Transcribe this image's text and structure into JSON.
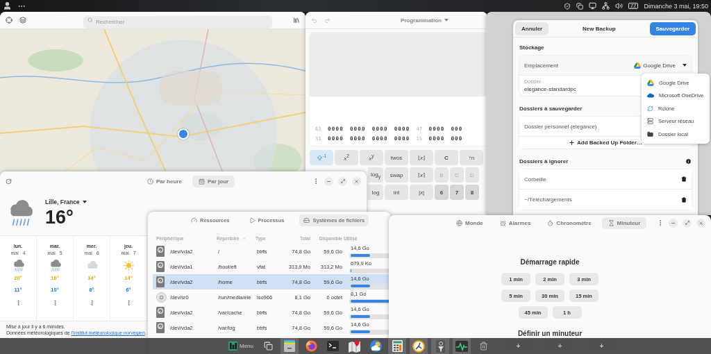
{
  "top_panel": {
    "indicator": "ZZ",
    "clock": "Dimanche 3 mai, 19:50"
  },
  "maps": {
    "search": {
      "placeholder": "Rechercher"
    }
  },
  "calculator": {
    "mode": "Programmation",
    "bit_rows": [
      {
        "segments": [
          {
            "label": "63",
            "groups": [
              "0000",
              "0000",
              "0000",
              "0000"
            ]
          },
          {
            "label": "47",
            "groups": [
              "0000",
              "000"
            ]
          }
        ]
      },
      {
        "segments": [
          {
            "label": "31",
            "groups": [
              "0000",
              "0000",
              "0000",
              "0000"
            ]
          },
          {
            "label": "15",
            "groups": [
              "0000",
              "000"
            ]
          }
        ]
      }
    ],
    "keys": [
      [
        {
          "label": "$^{-1}$",
          "kind": "toggle",
          "on": true
        },
        {
          "label": "*x*$^{2}$",
          "kind": "function"
        },
        {
          "label": "*x*$^{y}$",
          "kind": "function"
        },
        {
          "label": "twos",
          "kind": "function"
        },
        {
          "label": "⌊*x*⌋",
          "kind": "function"
        },
        {
          "label": "C",
          "kind": "clear"
        },
        {
          "label": "↑n",
          "kind": "function"
        }
      ],
      [
        {
          "label": "log$_{y}$",
          "kind": "function"
        },
        {
          "label": "swap",
          "kind": "function"
        },
        {
          "label": "⌈*x*⌉",
          "kind": "function"
        },
        {
          "label": "B",
          "kind": "digit",
          "disabled": true
        },
        {
          "label": "C",
          "kind": "digit",
          "disabled": true
        },
        {
          "label": "D",
          "kind": "digit",
          "disabled": true
        }
      ],
      [
        {
          "label": "log",
          "kind": "function"
        },
        {
          "label": "int",
          "kind": "function"
        },
        {
          "label": "|*x*|",
          "kind": "function"
        },
        {
          "label": "6",
          "kind": "digit",
          "disabled": false
        },
        {
          "label": "7",
          "kind": "digit",
          "disabled": false
        },
        {
          "label": "8",
          "kind": "digit",
          "disabled": false
        }
      ]
    ]
  },
  "backup": {
    "cancel": "Annuler",
    "title": "New Backup",
    "save": "Sauvegarder",
    "storage": {
      "heading": "Stockage",
      "location_label": "Emplacement",
      "location_value": "Google Drive",
      "folder_label": "Dossier",
      "folder_value": "elegance-standardpc"
    },
    "include": {
      "heading": "Dossiers à sauvegarder",
      "items": [
        "Dossier personnel (elegance)"
      ],
      "add": "Add Backed Up Folder…"
    },
    "exclude": {
      "heading": "Dossiers à ignorer",
      "items": [
        "Corbeille",
        "~/Téléchargements"
      ]
    },
    "location_menu": [
      {
        "label": "Google Drive",
        "kind": "gdrive"
      },
      {
        "label": "Microsoft OneDrive",
        "kind": "onedrive"
      },
      {
        "label": "Rclone",
        "kind": "rclone"
      },
      {
        "label": "Serveur réseau",
        "kind": "server"
      },
      {
        "label": "Dossier local",
        "kind": "folder"
      }
    ]
  },
  "weather": {
    "tabs": [
      {
        "label": "Par heure",
        "selected": false
      },
      {
        "label": "Par jour",
        "selected": true
      }
    ],
    "current": {
      "location": "Lille, France",
      "temperature": "16°",
      "kind": "rain"
    },
    "forecast": [
      {
        "day": "lun.",
        "month": "mai",
        "date": "4",
        "kind": "rain",
        "high": "20°",
        "low": "11°"
      },
      {
        "day": "mar.",
        "month": "mai",
        "date": "5",
        "kind": "rain",
        "high": "16°",
        "low": "10°"
      },
      {
        "day": "mer.",
        "month": "mai",
        "date": "6",
        "kind": "cloud",
        "high": "14°",
        "low": "8°"
      },
      {
        "day": "jeu.",
        "month": "mai",
        "date": "7",
        "kind": "sun",
        "high": "14°",
        "low": "6°"
      }
    ],
    "updated": "Mise à jour il y a 6 minutes.",
    "credit": "Données météorologiques de ",
    "credit_link": "l'Institut météorologique norvégien",
    "credit_end": "."
  },
  "system_monitor": {
    "tabs": [
      {
        "label": "Ressources",
        "selected": false
      },
      {
        "label": "Processus",
        "selected": false
      },
      {
        "label": "Systèmes de fichiers",
        "selected": true
      }
    ],
    "columns": [
      {
        "label": "Périphérique",
        "sorted": false
      },
      {
        "label": "Répertoire",
        "sorted": true
      },
      {
        "label": "Type",
        "sorted": false
      },
      {
        "label": "Total",
        "sorted": false
      },
      {
        "label": "Disponible",
        "sorted": false
      },
      {
        "label": "Utilisé",
        "sorted": false
      }
    ],
    "rows": [
      {
        "device": "/dev/vda2",
        "kind": "disk",
        "directory": "/",
        "type": "btrfs",
        "total": "74,8 Go",
        "available": "59,6 Go",
        "used": "14,6 Go",
        "level": 0.195,
        "selected": false
      },
      {
        "device": "/dev/vda1",
        "kind": "disk",
        "directory": "/boot/efi",
        "type": "vfat",
        "total": "313,9 Mo",
        "available": "313,2 Mo",
        "used": "679,9 Ko",
        "level": 0.002,
        "selected": false
      },
      {
        "device": "/dev/vda2",
        "kind": "disk",
        "directory": "/home",
        "type": "btrfs",
        "total": "74,8 Go",
        "available": "59,6 Go",
        "used": "14,6 Go",
        "level": 0.195,
        "selected": true
      },
      {
        "device": "/dev/sr0",
        "kind": "optical",
        "directory": "/run/media/ele",
        "type": "iso966",
        "total": "8,1 Go",
        "available": "0 octet",
        "used": "8,1 Go",
        "level": 1,
        "selected": false
      },
      {
        "device": "/dev/vda2",
        "kind": "disk",
        "directory": "/var/cache",
        "type": "btrfs",
        "total": "74,8 Go",
        "available": "59,6 Go",
        "used": "14,6 Go",
        "level": 0.195,
        "selected": false
      },
      {
        "device": "/dev/vda2",
        "kind": "disk",
        "directory": "/var/log",
        "type": "btrfs",
        "total": "74,8 Go",
        "available": "59,6 Go",
        "used": "14,6 Go",
        "level": 0.195,
        "selected": false
      }
    ]
  },
  "clock": {
    "tabs": [
      {
        "label": "Monde",
        "selected": false
      },
      {
        "label": "Alarmes",
        "selected": false
      },
      {
        "label": "Chronomètre",
        "selected": false
      },
      {
        "label": "Minuteur",
        "selected": true
      }
    ],
    "quick_start": "Démarrage rapide",
    "presets": [
      "1 min",
      "2 min",
      "3 min",
      "5 min",
      "30 min",
      "15 min",
      "45 min",
      "1 h"
    ],
    "set_timer": "Définir un minuteur"
  },
  "taskbar": [
    {
      "kind": "menu",
      "label": "Menu"
    },
    {
      "kind": "windows",
      "running": false
    },
    {
      "kind": "files",
      "running": true
    },
    {
      "kind": "browser",
      "running": false
    },
    {
      "kind": "terminal",
      "running": false
    },
    {
      "kind": "maps",
      "running": false
    },
    {
      "kind": "weather",
      "running": false
    },
    {
      "kind": "calculator",
      "running": true
    },
    {
      "kind": "clock",
      "running": true
    },
    {
      "kind": "filter",
      "running": true
    },
    {
      "kind": "monitor",
      "running": true
    },
    {
      "kind": "trash",
      "running": false
    },
    {
      "kind": "add",
      "label": "+"
    },
    {
      "kind": "add",
      "label": "+"
    },
    {
      "kind": "add",
      "label": "+"
    }
  ]
}
